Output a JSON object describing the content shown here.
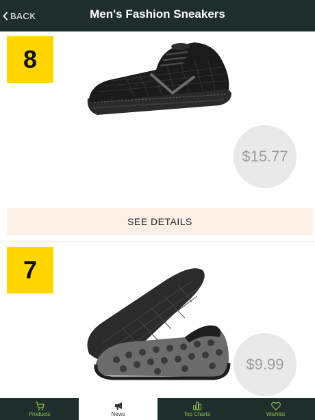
{
  "header": {
    "back_label": "BACK",
    "title": "Men's Fashion Sneakers"
  },
  "products": [
    {
      "rank": "8",
      "price": "$15.77",
      "details_label": "SEE DETAILS",
      "image_icon": "black-mesh-sneaker"
    },
    {
      "rank": "7",
      "price": "$9.99",
      "image_icon": "gray-polka-dot-water-shoe"
    }
  ],
  "tabs": [
    {
      "label": "Products",
      "icon": "cart-icon",
      "active": false
    },
    {
      "label": "News",
      "icon": "megaphone-icon",
      "active": true
    },
    {
      "label": "Top Charts",
      "icon": "bar-chart-icon",
      "active": false
    },
    {
      "label": "Wishlist",
      "icon": "heart-icon",
      "active": false
    }
  ],
  "colors": {
    "header_bg": "#1f2d2d",
    "badge": "#ffd600",
    "tab_accent": "#8bc34a",
    "details_bg": "#fdf1e7",
    "price_circle": "#e9e9e9"
  }
}
